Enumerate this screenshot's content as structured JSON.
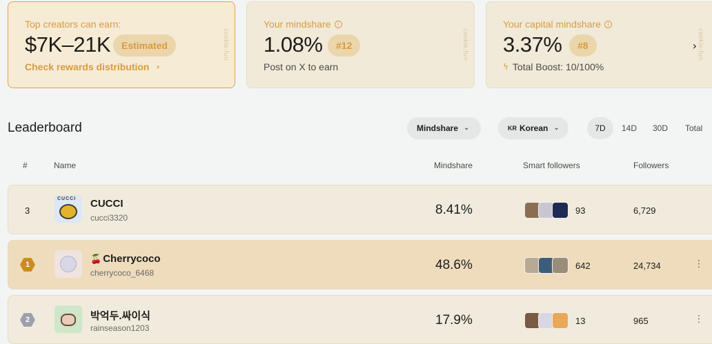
{
  "cards": {
    "earn": {
      "label": "Top creators can earn:",
      "value": "$7K–21K",
      "badge": "Estimated",
      "link": "Check rewards distribution",
      "watermark": "cookie.fun"
    },
    "mindshare": {
      "label": "Your mindshare",
      "value": "1.08%",
      "badge": "#12",
      "sub": "Post on X to earn",
      "watermark": "cookie.fun"
    },
    "capital": {
      "label": "Your capital mindshare",
      "value": "3.37%",
      "badge": "#8",
      "sub": "Total Boost: 10/100%",
      "watermark": "cookie.fun"
    }
  },
  "leaderboard": {
    "title": "Leaderboard",
    "metric_dropdown": "Mindshare",
    "language_flag": "KR",
    "language_dropdown": "Korean",
    "ranges": [
      "7D",
      "14D",
      "30D",
      "Total"
    ],
    "active_range": "7D",
    "columns": {
      "rank": "#",
      "name": "Name",
      "mindshare": "Mindshare",
      "smart_followers": "Smart followers",
      "followers": "Followers"
    },
    "rows": [
      {
        "rank": "3",
        "name": "CUCCI",
        "handle": "cucci3320",
        "mindshare": "8.41%",
        "smart_followers": "93",
        "followers": "6,729",
        "avatar_text": "CUCCI"
      },
      {
        "rank": "1",
        "name": "Cherrycoco",
        "handle": "cherrycoco_6468",
        "mindshare": "48.6%",
        "smart_followers": "642",
        "followers": "24,734"
      },
      {
        "rank": "2",
        "name": "박억두.싸이식",
        "handle": "rainseason1203",
        "mindshare": "17.9%",
        "smart_followers": "13",
        "followers": "965"
      }
    ]
  },
  "colors": {
    "accent": "#d99b40",
    "card_bg": "#f1ead9",
    "highlight_row": "#eedcbd",
    "gold_medal": "#c98c1f",
    "silver_medal": "#9aa1aa"
  }
}
